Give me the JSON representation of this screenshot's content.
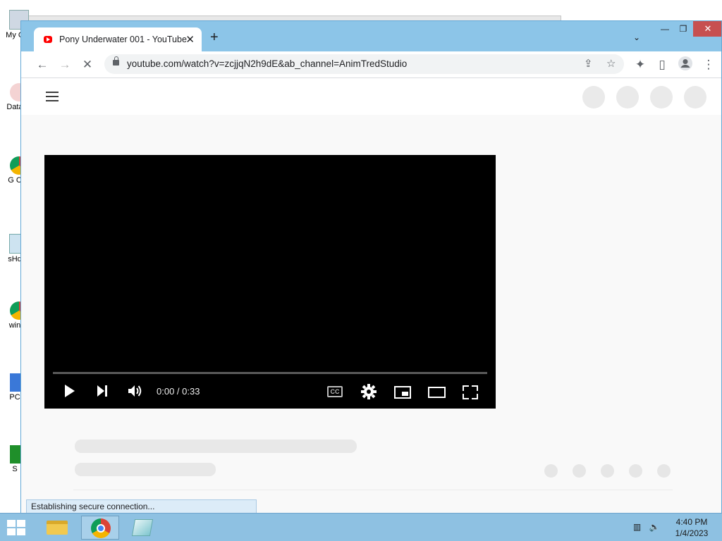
{
  "desktop": {
    "icons": [
      {
        "label": "My C",
        "name": "my-computer-icon"
      },
      {
        "label": "Data",
        "name": "data-icon"
      },
      {
        "label": "G C",
        "name": "chrome-shortcut-icon"
      },
      {
        "label": "sHd",
        "name": "shd-icon"
      },
      {
        "label": "win",
        "name": "win-icon"
      },
      {
        "label": "PC",
        "name": "pc-icon"
      },
      {
        "label": "S",
        "name": "s-icon"
      }
    ]
  },
  "browser": {
    "tab": {
      "title": "Pony Underwater 001 - YouTube",
      "close": "✕"
    },
    "new_tab": "+",
    "tab_search": "⌄",
    "window": {
      "minimize": "—",
      "maximize": "❐",
      "close": "✕"
    },
    "toolbar": {
      "back": "←",
      "forward": "→",
      "reload": "✕",
      "url": "youtube.com/watch?v=zcjjqN2h9dE&ab_channel=AnimTredStudio",
      "share": "⇪",
      "bookmark": "☆",
      "extensions": "✦",
      "sidepanel": "▯",
      "menu": "⋮"
    },
    "status": "Establishing secure connection..."
  },
  "player": {
    "time": "0:00 / 0:33",
    "cc": "CC",
    "progress": 0
  },
  "taskbar": {
    "time": "4:40 PM",
    "date": "1/4/2023"
  }
}
